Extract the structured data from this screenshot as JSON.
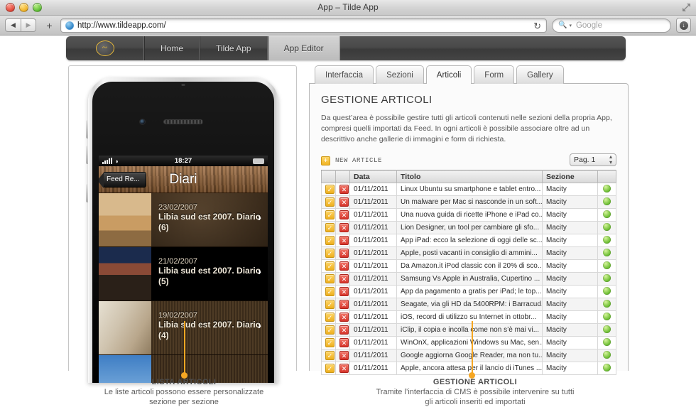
{
  "window": {
    "title": "App – Tilde App",
    "traffic_lights": [
      "close",
      "minimize",
      "zoom"
    ],
    "fullscreen_icon": "fullscreen-icon"
  },
  "toolbar": {
    "back_glyph": "◀",
    "forward_glyph": "▶",
    "plus_glyph": "+",
    "url": "http://www.tildeapp.com/",
    "reload_glyph": "↻",
    "search_placeholder": "Google",
    "search_value": "",
    "downloads_glyph": "↓"
  },
  "sitenav": {
    "logo": "~",
    "items": [
      {
        "label": "Home",
        "active": false
      },
      {
        "label": "Tilde App",
        "active": false
      },
      {
        "label": "App Editor",
        "active": true
      }
    ]
  },
  "phone": {
    "status": {
      "time": "18:27",
      "signal": "signal-icon",
      "wifi": "wifi-icon",
      "battery": "battery-icon"
    },
    "back_button": "Feed Re...",
    "title": "Diari",
    "articles": [
      {
        "date": "23/02/2007",
        "title": "Libia sud est 2007. Diario (6)"
      },
      {
        "date": "21/02/2007",
        "title": "Libia sud est 2007. Diario (5)"
      },
      {
        "date": "19/02/2007",
        "title": "Libia sud est 2007. Diario (4)"
      }
    ]
  },
  "cms": {
    "tabs": [
      {
        "label": "Interfaccia",
        "active": false
      },
      {
        "label": "Sezioni",
        "active": false
      },
      {
        "label": "Articoli",
        "active": true
      },
      {
        "label": "Form",
        "active": false
      },
      {
        "label": "Gallery",
        "active": false
      }
    ],
    "heading": "GESTIONE ARTICOLI",
    "intro": "Da quest’area è possibile gestire tutti gli articoli contenuti nelle sezioni della propria App, compresi quelli importati da Feed. In ogni articoli è possibile associare oltre ad un descrittivo anche gallerie di immagini e form di richiesta.",
    "new_article_label": "NEW ARTICLE",
    "new_article_icon": "plus-icon",
    "page_select": "Pag. 1",
    "columns": [
      "",
      "",
      "Data",
      "Titolo",
      "Sezione",
      ""
    ],
    "rows": [
      {
        "data": "01/11/2011",
        "titolo": "Linux Ubuntu su smartphone e tablet entro...",
        "sezione": "Macity",
        "stato": "online"
      },
      {
        "data": "01/11/2011",
        "titolo": "Un malware per Mac si nasconde in un soft...",
        "sezione": "Macity",
        "stato": "online"
      },
      {
        "data": "01/11/2011",
        "titolo": "Una nuova guida di ricette iPhone e iPad co...",
        "sezione": "Macity",
        "stato": "online"
      },
      {
        "data": "01/11/2011",
        "titolo": "Lion Designer, un tool per cambiare gli sfo...",
        "sezione": "Macity",
        "stato": "online"
      },
      {
        "data": "01/11/2011",
        "titolo": "App iPad: ecco la selezione di oggi delle sc...",
        "sezione": "Macity",
        "stato": "online"
      },
      {
        "data": "01/11/2011",
        "titolo": "Apple, posti vacanti in consiglio di ammini...",
        "sezione": "Macity",
        "stato": "online"
      },
      {
        "data": "01/11/2011",
        "titolo": "Da Amazon.it iPod classic con il 20% di sco...",
        "sezione": "Macity",
        "stato": "online"
      },
      {
        "data": "01/11/2011",
        "titolo": "Samsung Vs Apple in Australia, Cupertino ...",
        "sezione": "Macity",
        "stato": "online"
      },
      {
        "data": "01/11/2011",
        "titolo": "App da pagamento a gratis per iPad; le top...",
        "sezione": "Macity",
        "stato": "online"
      },
      {
        "data": "01/11/2011",
        "titolo": "Seagate, via gli HD da 5400RPM: i Barracud...",
        "sezione": "Macity",
        "stato": "online"
      },
      {
        "data": "01/11/2011",
        "titolo": "iOS, record di utilizzo su Internet in ottobr...",
        "sezione": "Macity",
        "stato": "online"
      },
      {
        "data": "01/11/2011",
        "titolo": "iClip, il copia e incolla come non s’è mai vi...",
        "sezione": "Macity",
        "stato": "online"
      },
      {
        "data": "01/11/2011",
        "titolo": "WinOnX, applicazioni Windows su Mac, sen...",
        "sezione": "Macity",
        "stato": "online"
      },
      {
        "data": "01/11/2011",
        "titolo": "Google aggiorna Google Reader, ma non tu...",
        "sezione": "Macity",
        "stato": "online"
      },
      {
        "data": "01/11/2011",
        "titolo": "Apple, ancora attesa per il lancio di iTunes ...",
        "sezione": "Macity",
        "stato": "online"
      }
    ],
    "row_action_ok": "✓",
    "row_action_delete": "✕"
  },
  "callouts": [
    {
      "title": "LISTA ARTICOLI",
      "body": "Le liste articoli possono essere personalizzate sezione per sezione"
    },
    {
      "title": "GESTIONE ARTICOLI",
      "body": "Tramite l’interfaccia di CMS è possibile intervenire su tutti gli articoli inseriti ed importati"
    }
  ],
  "colors": {
    "accent": "#f5a623",
    "status_online": "#6cbd33",
    "nav_bg": "#454545"
  }
}
